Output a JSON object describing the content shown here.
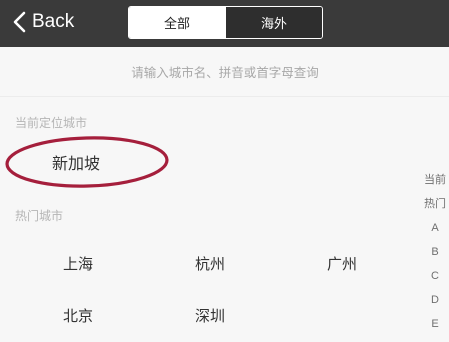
{
  "nav": {
    "back_label": "Back",
    "tabs": [
      {
        "label": "全部",
        "active": true
      },
      {
        "label": "海外",
        "active": false
      }
    ]
  },
  "search": {
    "placeholder": "请输入城市名、拼音或首字母查询"
  },
  "sections": {
    "current_location_header": "当前定位城市",
    "current_city": "新加坡",
    "hot_cities_header": "热门城市"
  },
  "hot_cities": [
    "上海",
    "杭州",
    "广州",
    "北京",
    "深圳"
  ],
  "index_items": [
    "当前",
    "热门",
    "A",
    "B",
    "C",
    "D",
    "E"
  ],
  "colors": {
    "topbar_bg": "#3a3a3a",
    "highlight_ring": "#a51f3c",
    "page_bg": "#f7f7f7"
  }
}
